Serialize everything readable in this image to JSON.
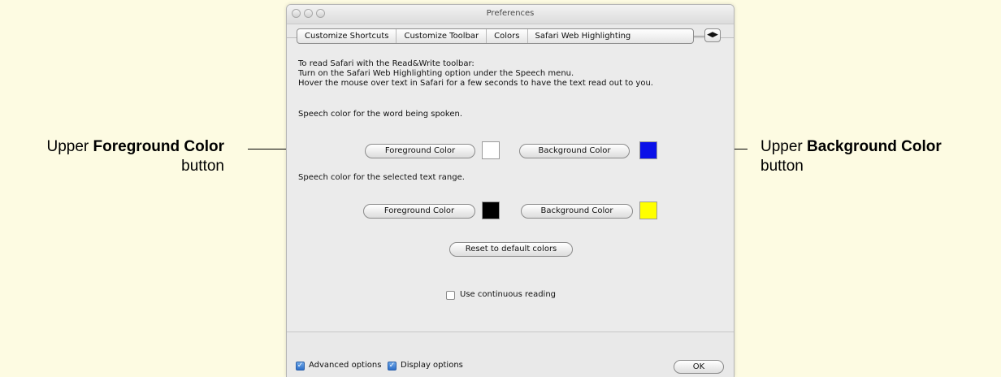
{
  "annotations": {
    "left": {
      "prefix": "Upper ",
      "bold": "Foreground Color",
      "suffix": "button"
    },
    "right": {
      "prefix": "Upper ",
      "bold": "Background Color",
      "suffix": "button"
    }
  },
  "window": {
    "title": "Preferences",
    "tabs": [
      "Customize Shortcuts",
      "Customize Toolbar",
      "Colors",
      "Safari Web Highlighting"
    ],
    "tab_scroll_icon": "left-right-arrows-icon"
  },
  "content": {
    "intro": [
      "To read Safari with the Read&Write toolbar:",
      "Turn on the Safari Web Highlighting option under the Speech menu.",
      "Hover the mouse over text in Safari for a few seconds to have the text read out to you."
    ],
    "section1_label": "Speech color for the word being spoken.",
    "section2_label": "Speech color for the selected text range.",
    "foreground_button": "Foreground Color",
    "background_button": "Background Color",
    "upper_foreground_color": "#ffffff",
    "upper_background_color": "#0a10e8",
    "lower_foreground_color": "#000000",
    "lower_background_color": "#ffff00",
    "reset_button": "Reset to default colors",
    "continuous_reading_label": "Use continuous reading",
    "continuous_reading_checked": false
  },
  "footer": {
    "advanced_options_label": "Advanced options",
    "advanced_options_checked": true,
    "display_options_label": "Display options",
    "display_options_checked": true,
    "ok_button": "OK"
  }
}
